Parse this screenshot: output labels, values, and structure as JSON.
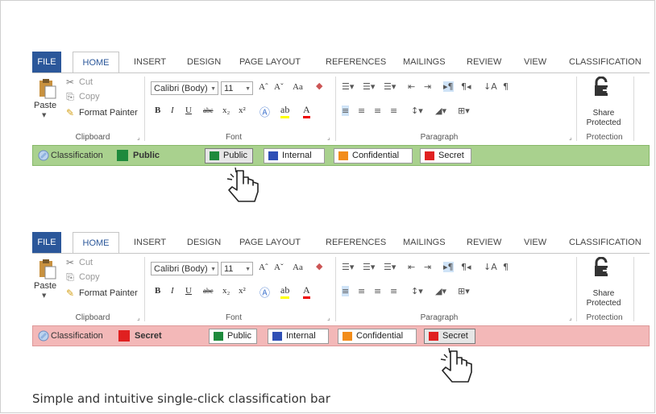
{
  "caption": "Simple and intuitive single-click classification bar",
  "colors": {
    "file_tab": "#2b579a",
    "public": "#1e8a3c",
    "internal": "#2f4fb5",
    "confidential": "#f28c1a",
    "secret": "#e02020",
    "bar_green": "#a9d18e",
    "bar_red": "#f3b8b8"
  },
  "ribbon": {
    "tabs": [
      "FILE",
      "HOME",
      "INSERT",
      "DESIGN",
      "PAGE LAYOUT",
      "REFERENCES",
      "MAILINGS",
      "REVIEW",
      "VIEW",
      "CLASSIFICATION"
    ],
    "clipboard": {
      "paste": "Paste",
      "cut": "Cut",
      "copy": "Copy",
      "format_painter": "Format Painter",
      "label": "Clipboard"
    },
    "font": {
      "family": "Calibri (Body)",
      "size": "11",
      "label": "Font",
      "bold": "B",
      "italic": "I",
      "underline": "U",
      "strike": "abc",
      "sub": "x₂",
      "sup": "x²",
      "case": "Aa",
      "grow": "Aˆ",
      "shrink": "Aˇ"
    },
    "paragraph": {
      "label": "Paragraph",
      "pilcrow": "¶"
    },
    "protection": {
      "share": "Share",
      "protected": "Protected",
      "label": "Protection"
    }
  },
  "top_bar": {
    "title": "Classification",
    "current": "Public",
    "buttons": [
      "Public",
      "Internal",
      "Confidential",
      "Secret"
    ]
  },
  "bottom_bar": {
    "title": "Classification",
    "current": "Secret",
    "buttons": [
      "Public",
      "Internal",
      "Confidential",
      "Secret"
    ]
  }
}
